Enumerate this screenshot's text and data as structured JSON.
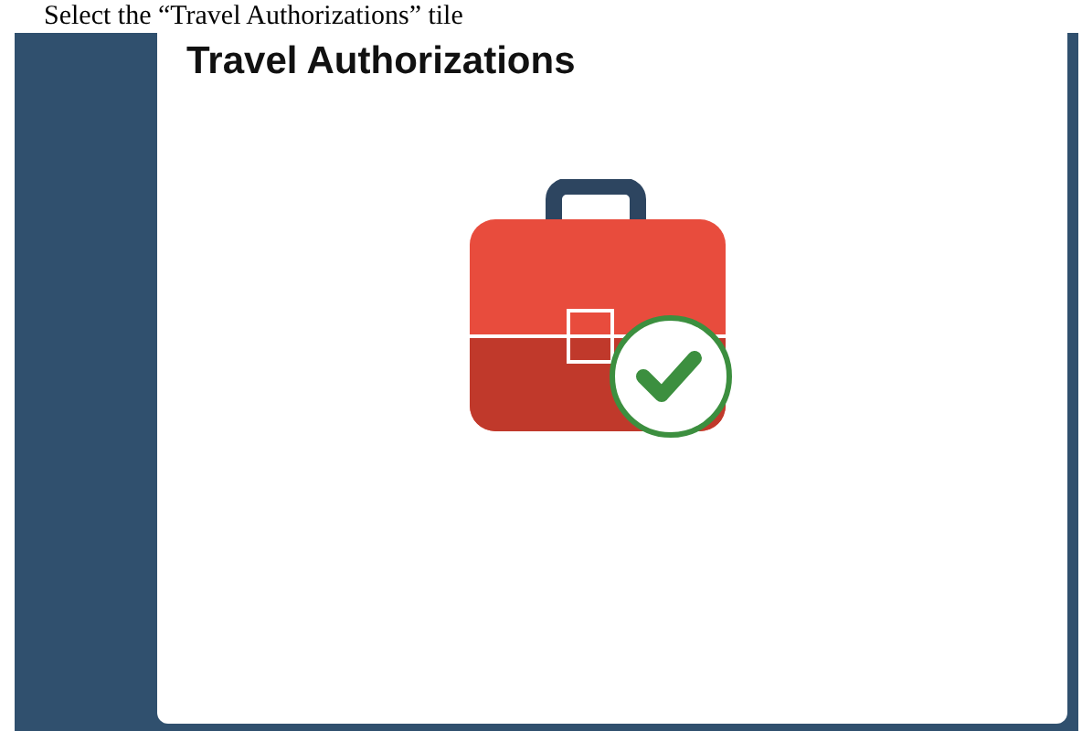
{
  "caption": "Select the “Travel Authorizations” tile",
  "tile": {
    "title": "Travel Authorizations"
  }
}
